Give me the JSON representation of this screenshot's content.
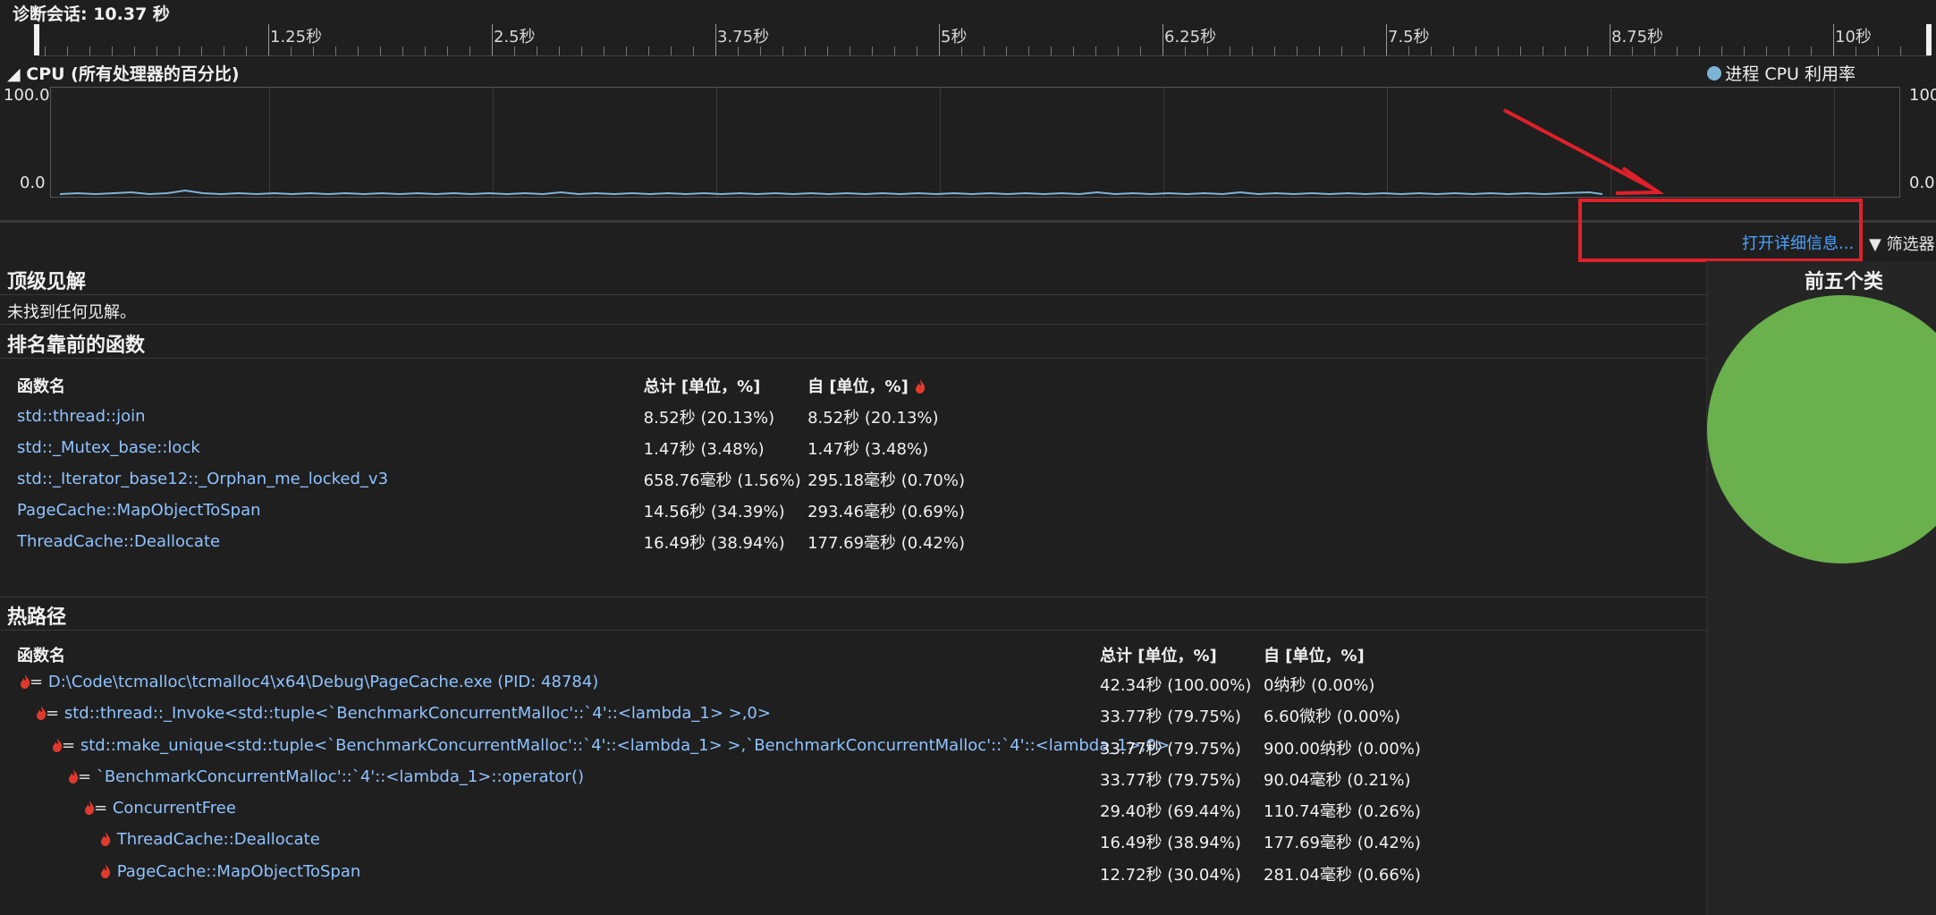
{
  "session": {
    "title": "诊断会话: 10.37 秒"
  },
  "ruler": {
    "labels": [
      "1.25秒",
      "2.5秒",
      "3.75秒",
      "5秒",
      "6.25秒",
      "7.5秒",
      "8.75秒",
      "10秒"
    ]
  },
  "cpu": {
    "header": "CPU (所有处理器的百分比)",
    "legend": "进程 CPU 利用率",
    "y_top_left": "100.0",
    "y_bottom_left": "0.0",
    "y_top_right": "100",
    "y_bottom_right": "0.0",
    "series_color": "#7db4d6"
  },
  "toolbar": {
    "details_link": "打开详细信息...",
    "filter": "筛选器"
  },
  "insights": {
    "title": "顶级见解",
    "message": "未找到任何见解。"
  },
  "top_functions": {
    "title": "排名靠前的函数",
    "columns": [
      "函数名",
      "总计 [单位，%]",
      "自 [单位，%]"
    ],
    "rows": [
      {
        "name": "std::thread::join",
        "total": "8.52秒 (20.13%)",
        "self": "8.52秒 (20.13%)"
      },
      {
        "name": "std::_Mutex_base::lock",
        "total": "1.47秒 (3.48%)",
        "self": "1.47秒 (3.48%)"
      },
      {
        "name": "std::_Iterator_base12::_Orphan_me_locked_v3",
        "total": "658.76毫秒 (1.56%)",
        "self": "295.18毫秒 (0.70%)"
      },
      {
        "name": "PageCache::MapObjectToSpan",
        "total": "14.56秒 (34.39%)",
        "self": "293.46毫秒 (0.69%)"
      },
      {
        "name": "ThreadCache::Deallocate",
        "total": "16.49秒 (38.94%)",
        "self": "177.69毫秒 (0.42%)"
      }
    ]
  },
  "hot_path": {
    "title": "热路径",
    "columns": [
      "函数名",
      "总计 [单位，%]",
      "自 [单位，%]"
    ],
    "rows": [
      {
        "name": "D:\\Code\\tcmalloc\\tcmalloc4\\x64\\Debug\\PageCache.exe (PID: 48784)",
        "total": "42.34秒 (100.00%)",
        "self": "0纳秒 (0.00%)"
      },
      {
        "name": "std::thread::_Invoke<std::tuple<`BenchmarkConcurrentMalloc'::`4'::<lambda_1> >,0>",
        "total": "33.77秒 (79.75%)",
        "self": "6.60微秒 (0.00%)"
      },
      {
        "name": "std::make_unique<std::tuple<`BenchmarkConcurrentMalloc'::`4'::<lambda_1> >,`BenchmarkConcurrentMalloc'::`4'::<lambda_1>,0>",
        "total": "33.77秒 (79.75%)",
        "self": "900.00纳秒 (0.00%)"
      },
      {
        "name": "`BenchmarkConcurrentMalloc'::`4'::<lambda_1>::operator()",
        "total": "33.77秒 (79.75%)",
        "self": "90.04毫秒 (0.21%)"
      },
      {
        "name": "ConcurrentFree",
        "total": "29.40秒 (69.44%)",
        "self": "110.74毫秒 (0.26%)"
      },
      {
        "name": "ThreadCache::Deallocate",
        "total": "16.49秒 (38.94%)",
        "self": "177.69毫秒 (0.42%)"
      },
      {
        "name": "PageCache::MapObjectToSpan",
        "total": "12.72秒 (30.04%)",
        "self": "281.04毫秒 (0.66%)"
      }
    ]
  },
  "top_categories": {
    "title": "前五个类",
    "pie_color": "#6ab04c"
  }
}
